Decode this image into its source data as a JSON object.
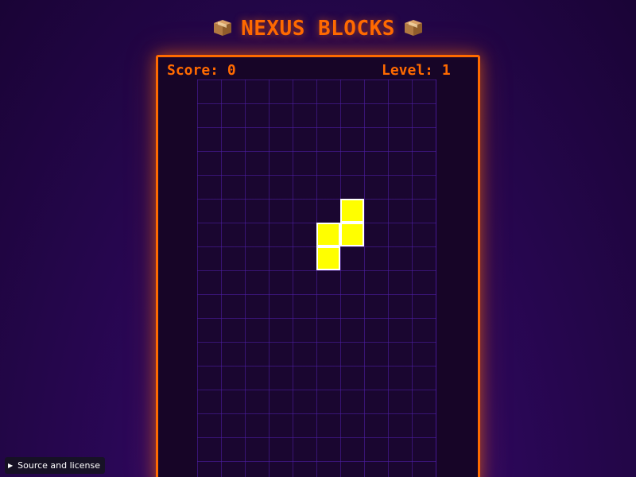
{
  "header": {
    "title": "NEXUS BLOCKS",
    "left_icon": "package-box-icon",
    "right_icon": "package-box-icon"
  },
  "hud": {
    "score_text": "Score: 0",
    "level_text": "Level: 1"
  },
  "board": {
    "columns": 10,
    "visible_rows": 17,
    "active_piece": {
      "type": "S",
      "orientation": "vertical",
      "color": "#ffff00",
      "outline": "#ffffff",
      "cells": [
        {
          "col": 6,
          "row": 5
        },
        {
          "col": 5,
          "row": 6
        },
        {
          "col": 6,
          "row": 6
        },
        {
          "col": 5,
          "row": 7
        }
      ]
    }
  },
  "footer": {
    "source_toggle_icon": "triangle-right-icon",
    "source_toggle_label": "Source and license"
  },
  "colors": {
    "accent": "#ff6a00",
    "background_top": "#1a0436",
    "background_bottom": "#4a0f86",
    "board_bg": "#1a0630",
    "grid_line": "#501eaa"
  }
}
